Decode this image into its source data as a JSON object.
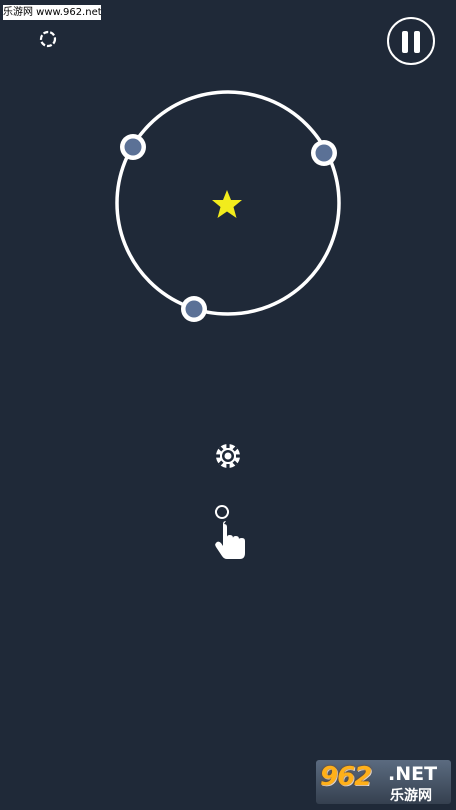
{
  "watermark": {
    "top_text": "乐游网 www.962.net"
  },
  "badge": {
    "number": "962",
    "net": ".NET",
    "cn": "乐游网"
  },
  "colors": {
    "background": "#1f2938",
    "ring": "#ffffff",
    "node_fill": "#5b7196",
    "star": "#f2ec1c"
  },
  "icons": {
    "restart": "restart-icon",
    "pause": "pause-icon",
    "star": "star-icon",
    "gear": "gear-icon",
    "tap_hint": "tap-hand-icon"
  }
}
